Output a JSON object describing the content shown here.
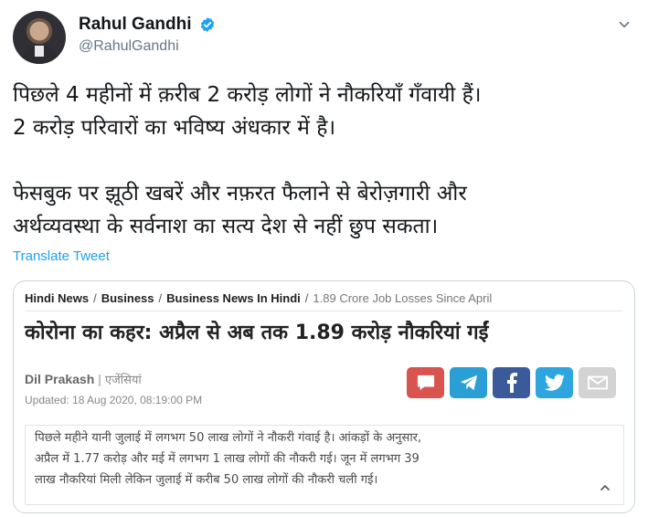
{
  "tweet": {
    "author_name": "Rahul Gandhi",
    "author_handle": "@RahulGandhi",
    "lines": [
      "पिछले 4 महीनों में क़रीब 2 करोड़ लोगों ने नौकरियाँ गँवायी हैं।",
      "2 करोड़ परिवारों का भविष्य अंधकार में है।",
      "फेसबुक पर झूठी खबरें और नफ़रत फैलाने से बेरोज़गारी और",
      "अर्थव्यवस्था के सर्वनाश का सत्य देश से नहीं छुप सकता।"
    ],
    "translate_label": "Translate Tweet"
  },
  "card": {
    "breadcrumb": [
      "Hindi News",
      "Business",
      "Business News In Hindi",
      "1.89 Crore Job Losses Since April"
    ],
    "headline": "कोरोना का कहर: अप्रैल से अब तक 1.89 करोड़ नौकरियां गईं",
    "author": "Dil Prakash",
    "agency": "एजेंसियां",
    "updated": "Updated: 18 Aug 2020, 08:19:00 PM",
    "excerpt_lines": [
      "पिछले महीने यानी जुलाई में लगभग 50 लाख लोगों ने नौकरी गंवाई है। आंकड़ों के अनुसार,",
      "अप्रैल में 1.77 करोड़ और मई में लगभग 1 लाख लोगों की नौकरी गई। जून में लगभग 39",
      "लाख नौकरियां मिली लेकिन जुलाई में करीब 50 लाख लोगों की नौकरी चली गई।"
    ]
  },
  "icons": {
    "verified": "verified-badge-icon",
    "menu": "chevron-down-icon",
    "share": [
      "comment-icon",
      "telegram-icon",
      "facebook-icon",
      "twitter-icon",
      "mail-icon"
    ],
    "collapse": "chevron-up-icon"
  },
  "colors": {
    "link": "#1da1f2",
    "verified": "#1da1f2",
    "comment": "#d9534f",
    "telegram": "#2a9fd6",
    "facebook": "#3b5a9a",
    "twitter": "#2fa5e0",
    "mail": "#d3d3d3"
  }
}
